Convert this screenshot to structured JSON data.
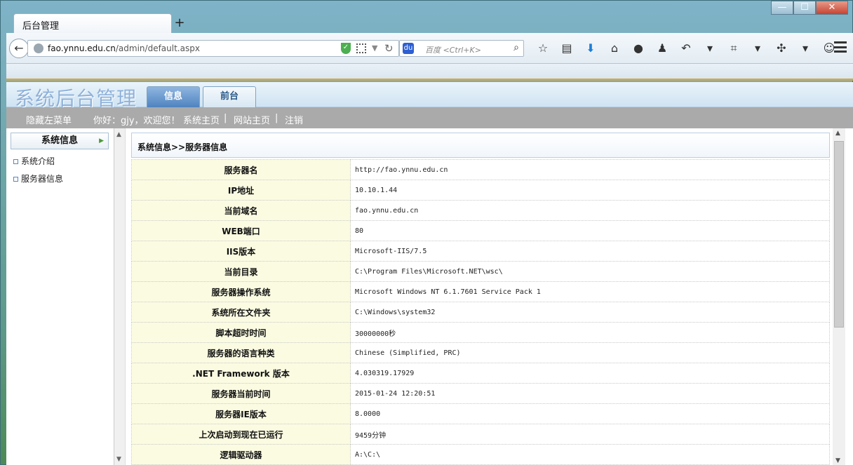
{
  "browser": {
    "tab_title": "后台管理",
    "new_tab": "+",
    "url_domain": "fao.ynnu.edu.cn",
    "url_path": "/admin/default.aspx",
    "search_placeholder": "百度 <Ctrl+K>",
    "window_controls": [
      "—",
      "☐",
      "✕"
    ]
  },
  "header": {
    "logo": "系统后台管理",
    "tabs": [
      "信息",
      "前台"
    ]
  },
  "topbar": {
    "hide_menu": "隐藏左菜单",
    "greeting": "你好：gjy，欢迎您！",
    "links": [
      "系统主页",
      "网站主页",
      "注销"
    ],
    "separator": "|"
  },
  "sidebar": {
    "heading": "系统信息",
    "items": [
      "系统介绍",
      "服务器信息"
    ]
  },
  "main": {
    "breadcrumb": "系统信息>>服务器信息",
    "rows": [
      {
        "label": "服务器名",
        "value": "http://fao.ynnu.edu.cn"
      },
      {
        "label": "IP地址",
        "value": "10.10.1.44"
      },
      {
        "label": "当前域名",
        "value": "fao.ynnu.edu.cn"
      },
      {
        "label": "WEB端口",
        "value": "80"
      },
      {
        "label": "IIS版本",
        "value": "Microsoft-IIS/7.5"
      },
      {
        "label": "当前目录",
        "value": "C:\\Program Files\\Microsoft.NET\\wsc\\"
      },
      {
        "label": "服务器操作系统",
        "value": "Microsoft Windows NT 6.1.7601 Service Pack 1"
      },
      {
        "label": "系统所在文件夹",
        "value": "C:\\Windows\\system32"
      },
      {
        "label": "脚本超时时间",
        "value": "30000000秒"
      },
      {
        "label": "服务器的语言种类",
        "value": "Chinese (Simplified, PRC)"
      },
      {
        "label": ".NET Framework 版本",
        "value": "4.030319.17929"
      },
      {
        "label": "服务器当前时间",
        "value": "2015-01-24 12:20:51"
      },
      {
        "label": "服务器IE版本",
        "value": "8.0000"
      },
      {
        "label": "上次启动到现在已运行",
        "value": "9459分钟"
      },
      {
        "label": "逻辑驱动器",
        "value": "A:\\C:\\"
      }
    ]
  }
}
